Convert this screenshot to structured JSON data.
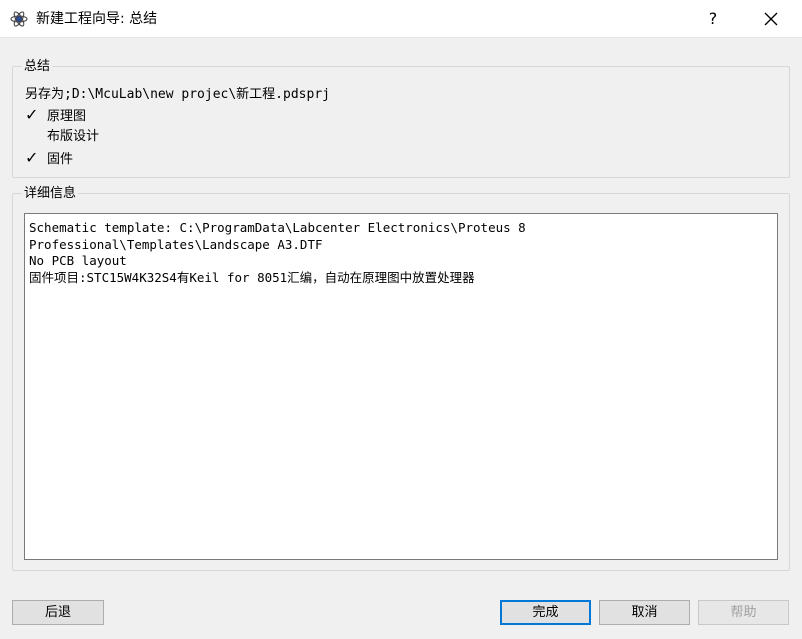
{
  "window": {
    "title": "新建工程向导: 总结",
    "help_label": "?",
    "close_label": "✕"
  },
  "summary": {
    "group_title": "总结",
    "save_as": "另存为;D:\\McuLab\\new projec\\新工程.pdsprj",
    "items": [
      {
        "label": "原理图",
        "checked": true,
        "mark": "✓"
      },
      {
        "label": "布版设计",
        "checked": false,
        "mark": ""
      },
      {
        "label": "固件",
        "checked": true,
        "mark": "✓"
      }
    ]
  },
  "details": {
    "group_title": "详细信息",
    "text": "Schematic template: C:\\ProgramData\\Labcenter Electronics\\Proteus 8\nProfessional\\Templates\\Landscape A3.DTF\nNo PCB layout\n固件项目:STC15W4K32S4有Keil for 8051汇编，自动在原理图中放置处理器"
  },
  "buttons": {
    "back": "后退",
    "finish": "完成",
    "cancel": "取消",
    "help": "帮助"
  }
}
